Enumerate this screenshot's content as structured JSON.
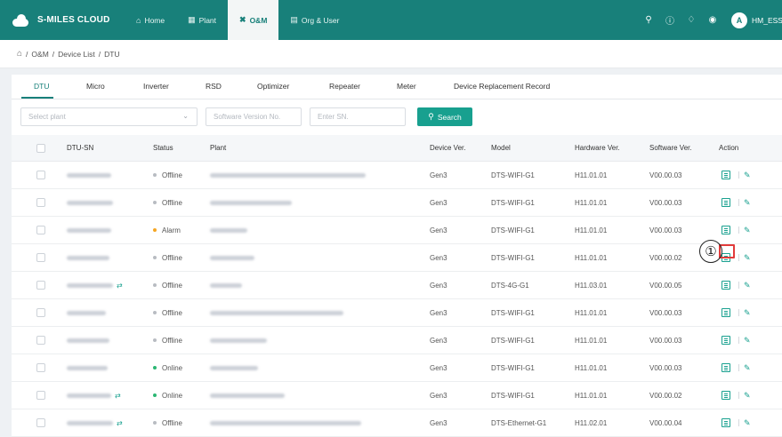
{
  "brand": {
    "name": "S-MILES CLOUD"
  },
  "nav": [
    {
      "label": "Home",
      "icon": "home-icon"
    },
    {
      "label": "Plant",
      "icon": "plant-icon"
    },
    {
      "label": "O&M",
      "icon": "tools-icon",
      "active": true
    },
    {
      "label": "Org & User",
      "icon": "org-icon"
    }
  ],
  "user": {
    "name": "HM_ESS_",
    "avatar_letter": "A"
  },
  "breadcrumb": [
    "O&M",
    "Device List",
    "DTU"
  ],
  "tabs": [
    {
      "label": "DTU",
      "active": true
    },
    {
      "label": "Micro"
    },
    {
      "label": "Inverter"
    },
    {
      "label": "RSD"
    },
    {
      "label": "Optimizer"
    },
    {
      "label": "Repeater"
    },
    {
      "label": "Meter"
    },
    {
      "label": "Device Replacement Record"
    }
  ],
  "filters": {
    "plant_placeholder": "Select plant",
    "software_placeholder": "Software Version No.",
    "sn_placeholder": "Enter SN.",
    "search_label": "Search"
  },
  "table": {
    "columns": [
      "DTU-SN",
      "Status",
      "Plant",
      "Device Ver.",
      "Model",
      "Hardware Ver.",
      "Software Ver.",
      "Action"
    ],
    "rows": [
      {
        "status": "Offline",
        "device_ver": "Gen3",
        "model": "DTS-WIFI-G1",
        "hardware": "H11.01.01",
        "software": "V00.00.03",
        "link": false
      },
      {
        "status": "Offline",
        "device_ver": "Gen3",
        "model": "DTS-WIFI-G1",
        "hardware": "H11.01.01",
        "software": "V00.00.03",
        "link": false
      },
      {
        "status": "Alarm",
        "device_ver": "Gen3",
        "model": "DTS-WIFI-G1",
        "hardware": "H11.01.01",
        "software": "V00.00.03",
        "link": false
      },
      {
        "status": "Offline",
        "device_ver": "Gen3",
        "model": "DTS-WIFI-G1",
        "hardware": "H11.01.01",
        "software": "V00.00.02",
        "link": false
      },
      {
        "status": "Offline",
        "device_ver": "Gen3",
        "model": "DTS-4G-G1",
        "hardware": "H11.03.01",
        "software": "V00.00.05",
        "link": true
      },
      {
        "status": "Offline",
        "device_ver": "Gen3",
        "model": "DTS-WIFI-G1",
        "hardware": "H11.01.01",
        "software": "V00.00.03",
        "link": false
      },
      {
        "status": "Offline",
        "device_ver": "Gen3",
        "model": "DTS-WIFI-G1",
        "hardware": "H11.01.01",
        "software": "V00.00.03",
        "link": false
      },
      {
        "status": "Online",
        "device_ver": "Gen3",
        "model": "DTS-WIFI-G1",
        "hardware": "H11.01.01",
        "software": "V00.00.03",
        "link": false
      },
      {
        "status": "Online",
        "device_ver": "Gen3",
        "model": "DTS-WIFI-G1",
        "hardware": "H11.01.01",
        "software": "V00.00.02",
        "link": true
      },
      {
        "status": "Offline",
        "device_ver": "Gen3",
        "model": "DTS-Ethernet-G1",
        "hardware": "H11.02.01",
        "software": "V00.00.04",
        "link": true
      }
    ]
  },
  "status_colors": {
    "Offline": "#b8bcc2",
    "Alarm": "#f5a623",
    "Online": "#2bb673"
  },
  "annotation": {
    "marker": "①"
  },
  "colors": {
    "brand": "#18807a",
    "accent": "#18a08f",
    "highlight": "#e23b3b"
  }
}
